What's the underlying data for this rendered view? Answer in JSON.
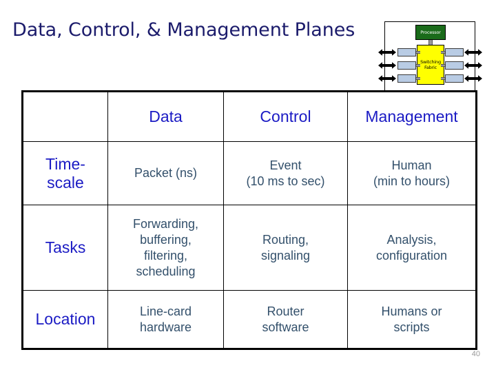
{
  "slide": {
    "title": "Data, Control, & Management Planes",
    "page_number": "40"
  },
  "colors": {
    "title": "#1b1b6b",
    "header_text": "#1b1bc4",
    "row_label": "#1b1bc4",
    "cell_text": "#33506b",
    "processor_fill": "#1a6b1a",
    "fabric_fill": "#ffff00",
    "linecard_fill": "#b9cce4",
    "border": "#000000",
    "page_number": "#9a9a9a"
  },
  "router_diagram": {
    "processor_label": "Processor",
    "fabric_label_line1": "Switching",
    "fabric_label_line2": "Fabric",
    "port_count": 3
  },
  "table": {
    "corner_label": "",
    "columns": [
      "",
      "Data",
      "Control",
      "Management"
    ],
    "rows": [
      {
        "label": "Time-\nscale",
        "label_line1": "Time-",
        "label_line2": "scale",
        "cells": [
          "Packet (ns)",
          "Event\n(10 ms to sec)",
          "Human\n(min to hours)"
        ]
      },
      {
        "label": "Tasks",
        "cells": [
          "Forwarding,\nbuffering,\nfiltering,\nscheduling",
          "Routing,\nsignaling",
          "Analysis,\nconfiguration"
        ]
      },
      {
        "label": "Location",
        "cells": [
          "Line-card\nhardware",
          "Router\nsoftware",
          "Humans or\nscripts"
        ]
      }
    ]
  }
}
